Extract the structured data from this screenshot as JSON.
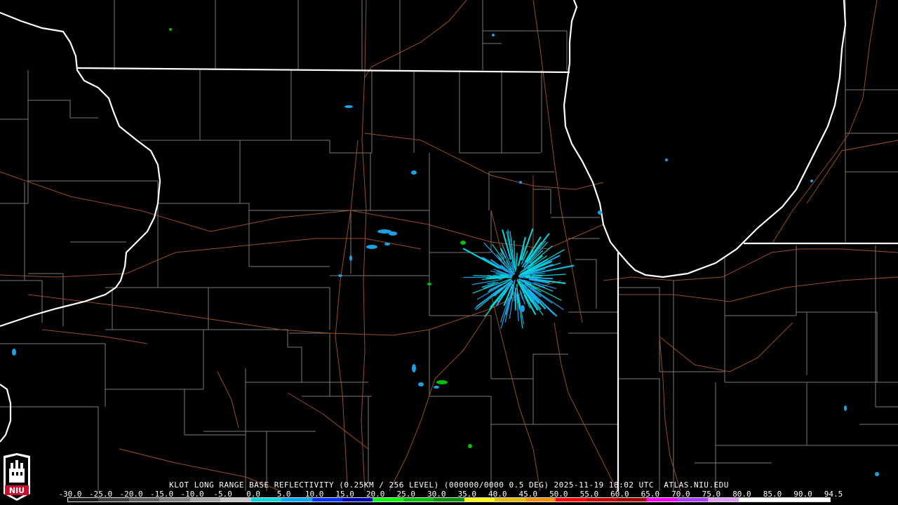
{
  "product": {
    "title": "KLOT LONG RANGE BASE REFLECTIVITY (0.25KM / 256 LEVEL) (000000/0000 0.5 DEG) 2025-11-19 18:02 UTC  ATLAS.NIU.EDU"
  },
  "legend": {
    "ticks": [
      "-30.0",
      "-25.0",
      "-20.0",
      "-15.0",
      "-10.0",
      "-5.0",
      "0.0",
      "5.0",
      "10.0",
      "15.0",
      "20.0",
      "25.0",
      "30.0",
      "35.0",
      "40.0",
      "45.0",
      "50.0",
      "55.0",
      "60.0",
      "65.0",
      "70.0",
      "75.0",
      "80.0",
      "85.0",
      "90.0",
      "94.5"
    ],
    "colors": [
      "#1a1a1a",
      "#3c3c3c",
      "#5f5f5f",
      "#828282",
      "#a4a4a4",
      "#c6c6c6",
      "#00dada",
      "#00a8ff",
      "#0030ff",
      "#0000b0",
      "#00ff00",
      "#00c000",
      "#009000",
      "#ffff00",
      "#e6c000",
      "#ff9000",
      "#ff0000",
      "#c80000",
      "#a00000",
      "#ff00ff",
      "#b040ff",
      "#e0a0ff",
      "#ffffff",
      "#ffffff",
      "#ffffff"
    ]
  },
  "logo": {
    "text": "NIU",
    "color": "#c8102e"
  },
  "colors": {
    "state_border": "#ffffff",
    "county_border": "#7a7a7a",
    "highway": "#a0522d",
    "echo_light": "#1fa0e6",
    "echo_mid": "#00dada",
    "echo_green": "#00c000"
  }
}
